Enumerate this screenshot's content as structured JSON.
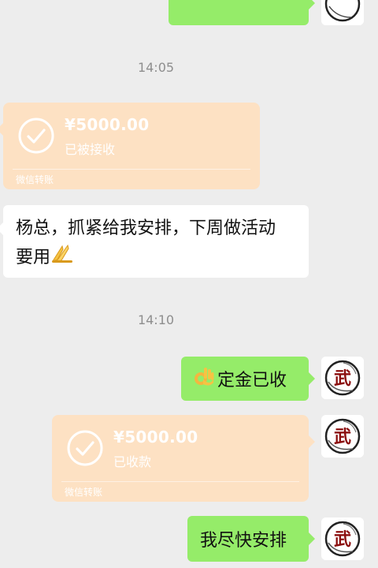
{
  "times": [
    "14:05",
    "14:10"
  ],
  "transfers": [
    {
      "amount": "¥5000.00",
      "status": "已被接收",
      "brand": "微信转账"
    },
    {
      "amount": "¥5000.00",
      "status": "已收款",
      "brand": "微信转账"
    }
  ],
  "messages": {
    "incoming_line1": "杨总，抓紧给我安排，下周做活动",
    "incoming_line2": "要用",
    "deposit": "定金已收",
    "arrange": "我尽快安排"
  },
  "avatar_char": "武",
  "colors": {
    "background": "#ededed",
    "outgoing_bubble": "#95ec69",
    "incoming_bubble": "#ffffff",
    "transfer_card": "#fde1c3",
    "time_text": "#8e8e8e"
  },
  "icons": [
    "check-circle-icon",
    "ok-hand-emoji",
    "pray-hands-emoji"
  ]
}
